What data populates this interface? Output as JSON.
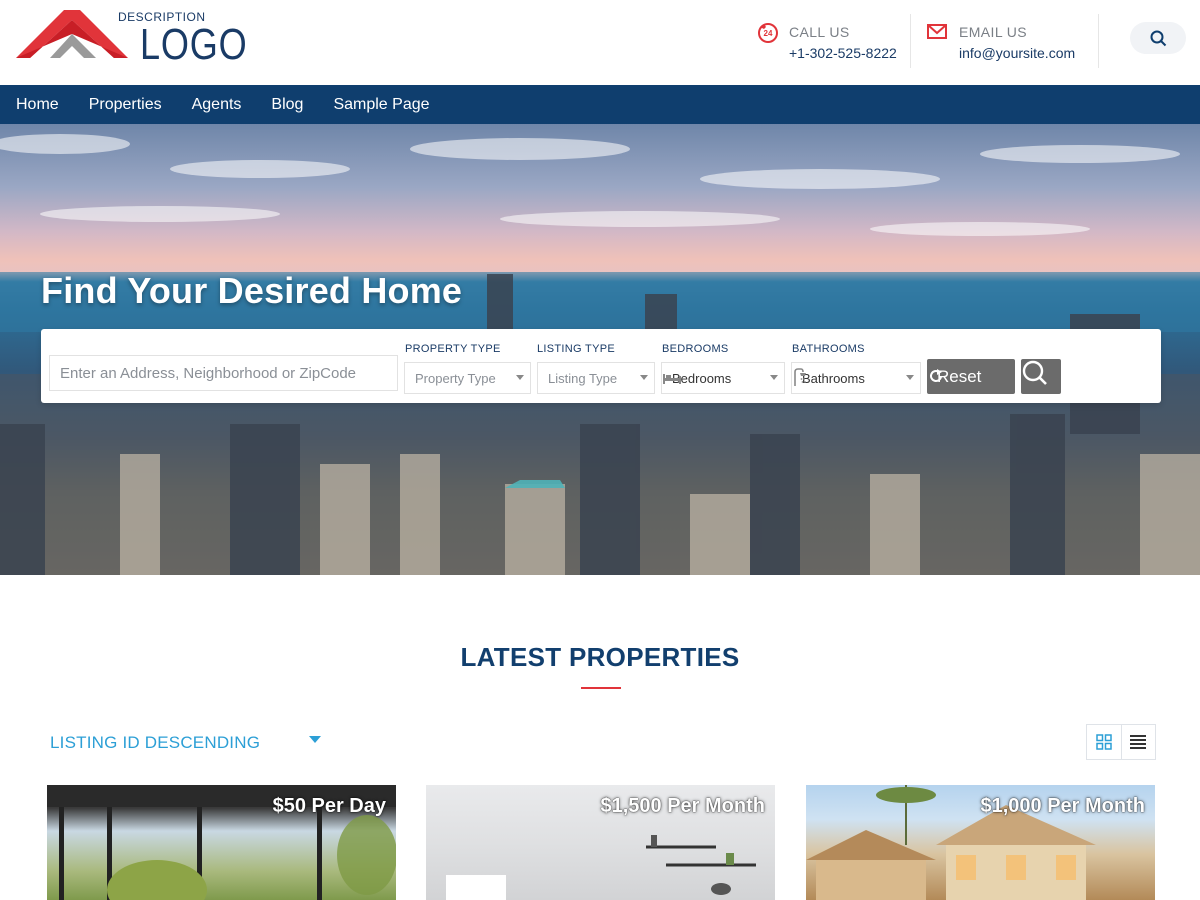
{
  "brand": {
    "description": "DESCRIPTION",
    "logo_text": "LOGO",
    "colors": {
      "primary": "#0f3e6e",
      "accent": "#e1343a",
      "link": "#2c9fd6"
    }
  },
  "contact": {
    "call_label": "CALL US",
    "call_value": "+1-302-525-8222",
    "call_icon": "phone-24-icon",
    "email_label": "EMAIL US",
    "email_value": "info@yoursite.com",
    "email_icon": "envelope-icon"
  },
  "nav": {
    "items": [
      {
        "label": "Home"
      },
      {
        "label": "Properties"
      },
      {
        "label": "Agents"
      },
      {
        "label": "Blog"
      },
      {
        "label": "Sample Page"
      }
    ]
  },
  "hero": {
    "title": "Find Your Desired Home"
  },
  "search": {
    "address_placeholder": "Enter an Address, Neighborhood or ZipCode",
    "property_type": {
      "label": "PROPERTY TYPE",
      "value": "Property Type"
    },
    "listing_type": {
      "label": "LISTING TYPE",
      "value": "Listing Type"
    },
    "bedrooms": {
      "label": "BEDROOMS",
      "value": "Bedrooms"
    },
    "bathrooms": {
      "label": "BATHROOMS",
      "value": "Bathrooms"
    },
    "reset_label": "Reset"
  },
  "latest": {
    "title": "LATEST PROPERTIES",
    "sort_label": "LISTING ID DESCENDING",
    "cards": [
      {
        "price": "$50 Per Day"
      },
      {
        "price": "$1,500 Per Month"
      },
      {
        "price": "$1,000 Per Month"
      }
    ]
  }
}
